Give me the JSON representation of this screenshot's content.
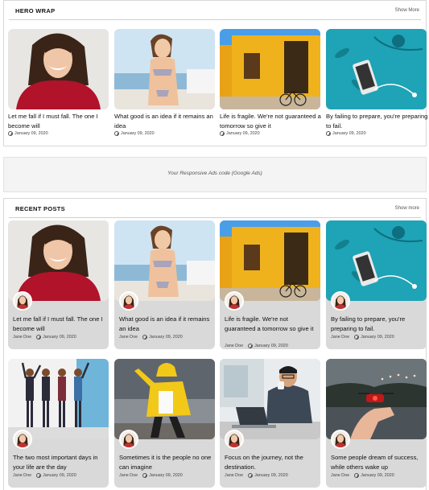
{
  "hero_wrap": {
    "title": "HERO WRAP",
    "show_more": "Show More",
    "posts": [
      {
        "title": "Let me fall if I must fall. The one I become will",
        "date": "January 09, 2020",
        "image": "woman-red-sweater"
      },
      {
        "title": "What good is an idea if it remains an idea",
        "date": "January 09, 2020",
        "image": "woman-bikini-beach"
      },
      {
        "title": "Life is fragile. We're not guaranteed a tomorrow so give it",
        "date": "January 09, 2020",
        "image": "yellow-house-bicycle"
      },
      {
        "title": "By failing to prepare, you're preparing to fail.",
        "date": "January 09, 2020",
        "image": "phone-headphones-teal"
      }
    ]
  },
  "ads": {
    "text": "Your Responsive Ads code (Google Ads)"
  },
  "recent_posts": {
    "title": "RECENT POSTS",
    "show_more": "Show more",
    "posts": [
      {
        "title": "Let me fall if I must fall. The one I become will",
        "author": "Jane Doe",
        "date": "January 09, 2020",
        "image": "woman-red-sweater"
      },
      {
        "title": "What good is an idea if it remains an idea",
        "author": "Jane Doe",
        "date": "January 09, 2020",
        "image": "woman-bikini-beach"
      },
      {
        "title": "Life is fragile. We're not guaranteed a tomorrow so give it",
        "author": "Jane Doe",
        "date": "January 09, 2020",
        "image": "yellow-house-bicycle"
      },
      {
        "title": "By failing to prepare, you're preparing to fail.",
        "author": "Jane Doe",
        "date": "January 09, 2020",
        "image": "phone-headphones-teal"
      },
      {
        "title": "The two most important days in your life are the day",
        "author": "Jane Doe",
        "date": "January 09, 2020",
        "image": "four-women-blue-wall"
      },
      {
        "title": "Sometimes it is the people no one can imagine",
        "author": "Jane Doe",
        "date": "January 09, 2020",
        "image": "yellow-jacket-dancer"
      },
      {
        "title": "Focus on the journey, not the destination.",
        "author": "Jane Doe",
        "date": "January 09, 2020",
        "image": "man-laptop-coffee"
      },
      {
        "title": "Some people dream of success, while others wake up",
        "author": "Jane Doe",
        "date": "January 09, 2020",
        "image": "hand-red-drone"
      }
    ]
  }
}
